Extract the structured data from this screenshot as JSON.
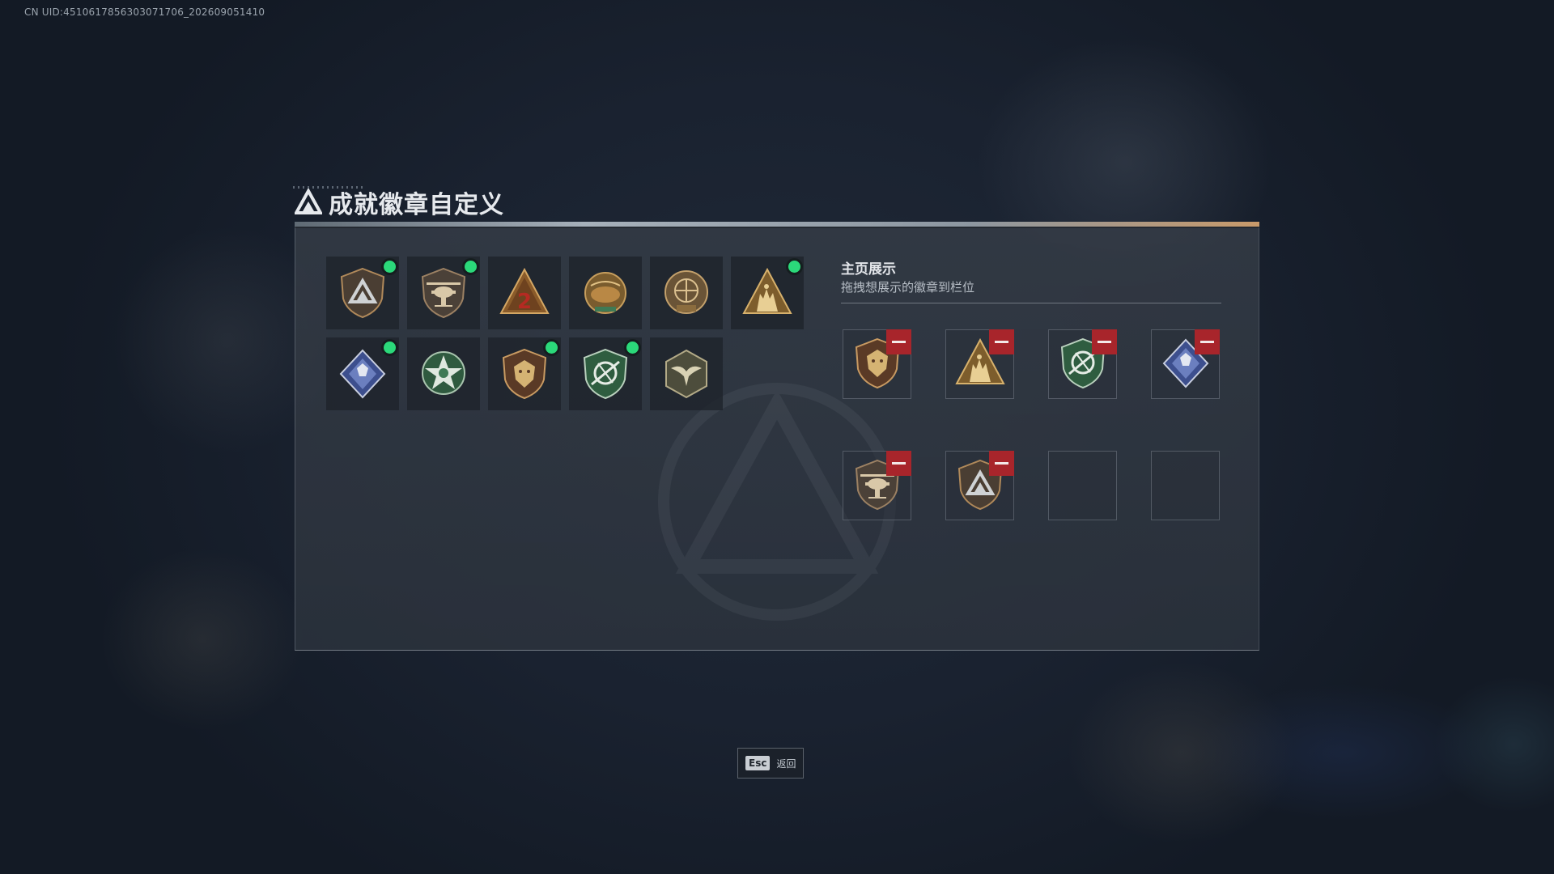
{
  "meta": {
    "uid": "CN UID:4510617856303071706_202609051410"
  },
  "header": {
    "title": "成就徽章自定义",
    "icon": "delta-logo-icon"
  },
  "collection": {
    "badges": [
      {
        "name": "badge-delta-shield",
        "icon": "delta-shield-icon",
        "new": true
      },
      {
        "name": "badge-helicopter",
        "icon": "helicopter-icon",
        "new": true
      },
      {
        "name": "badge-number-2",
        "icon": "number-two-triangle-icon",
        "new": false
      },
      {
        "name": "badge-delta-force-gold",
        "icon": "delta-force-seal-icon",
        "new": false
      },
      {
        "name": "badge-season-2025",
        "icon": "season-2025-seal-icon",
        "new": false
      },
      {
        "name": "badge-soldiers-triangle",
        "icon": "soldiers-triangle-icon",
        "new": true
      },
      {
        "name": "badge-crystal-diamond",
        "icon": "crystal-diamond-icon",
        "new": true
      },
      {
        "name": "badge-green-star",
        "icon": "green-star-icon",
        "new": false
      },
      {
        "name": "badge-lion-shield",
        "icon": "lion-shield-icon",
        "new": true
      },
      {
        "name": "badge-green-rotor-shield",
        "icon": "green-rotor-shield-icon",
        "new": true
      },
      {
        "name": "badge-eagle-hexagon",
        "icon": "eagle-hexagon-icon",
        "new": false
      }
    ]
  },
  "showcase": {
    "title": "主页展示",
    "subtitle": "拖拽想展示的徽章到栏位",
    "slots": [
      {
        "icon": "lion-shield-icon",
        "filled": true
      },
      {
        "icon": "soldiers-triangle-icon",
        "filled": true
      },
      {
        "icon": "green-rotor-shield-icon",
        "filled": true
      },
      {
        "icon": "crystal-diamond-icon",
        "filled": true
      },
      {
        "icon": "helicopter-icon",
        "filled": true
      },
      {
        "icon": "delta-shield-icon",
        "filled": true
      },
      {
        "icon": "",
        "filled": false
      },
      {
        "icon": "",
        "filled": false
      }
    ]
  },
  "footer": {
    "esc_key": "Esc",
    "back_label": "返回"
  },
  "colors": {
    "new_dot": "#2bd97a",
    "remove": "#a8252b",
    "gold": "#c9a160",
    "green": "#3f7a55"
  }
}
